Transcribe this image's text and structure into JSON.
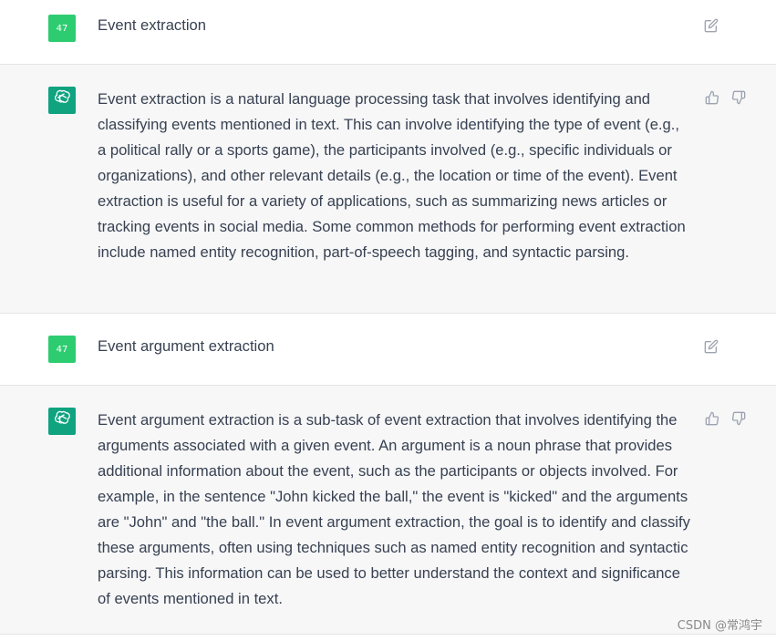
{
  "messages": [
    {
      "role": "user",
      "avatar_label": "47",
      "text": "Event extraction"
    },
    {
      "role": "assistant",
      "text": "Event extraction is a natural language processing task that involves identifying and classifying events mentioned in text. This can involve identifying the type of event (e.g., a political rally or a sports game), the participants involved (e.g., specific individuals or organizations), and other relevant details (e.g., the location or time of the event). Event extraction is useful for a variety of applications, such as summarizing news articles or tracking events in social media. Some common methods for performing event extraction include named entity recognition, part-of-speech tagging, and syntactic parsing."
    },
    {
      "role": "user",
      "avatar_label": "47",
      "text": "Event argument extraction"
    },
    {
      "role": "assistant",
      "text": "Event argument extraction is a sub-task of event extraction that involves identifying the arguments associated with a given event. An argument is a noun phrase that provides additional information about the event, such as the participants or objects involved. For example, in the sentence \"John kicked the ball,\" the event is \"kicked\" and the arguments are \"John\" and \"the ball.\" In event argument extraction, the goal is to identify and classify these arguments, often using techniques such as named entity recognition and syntactic parsing. This information can be used to better understand the context and significance of events mentioned in text."
    }
  ],
  "icons": {
    "edit": "edit-icon",
    "thumbs_up": "thumbs-up-icon",
    "thumbs_down": "thumbs-down-icon",
    "assistant_logo": "openai-logo-icon"
  },
  "colors": {
    "user_avatar": "#2ecc71",
    "assistant_avatar": "#10a37f",
    "assistant_bg": "#f7f7f8",
    "text": "#374151"
  },
  "watermark": "CSDN @常鸿宇"
}
